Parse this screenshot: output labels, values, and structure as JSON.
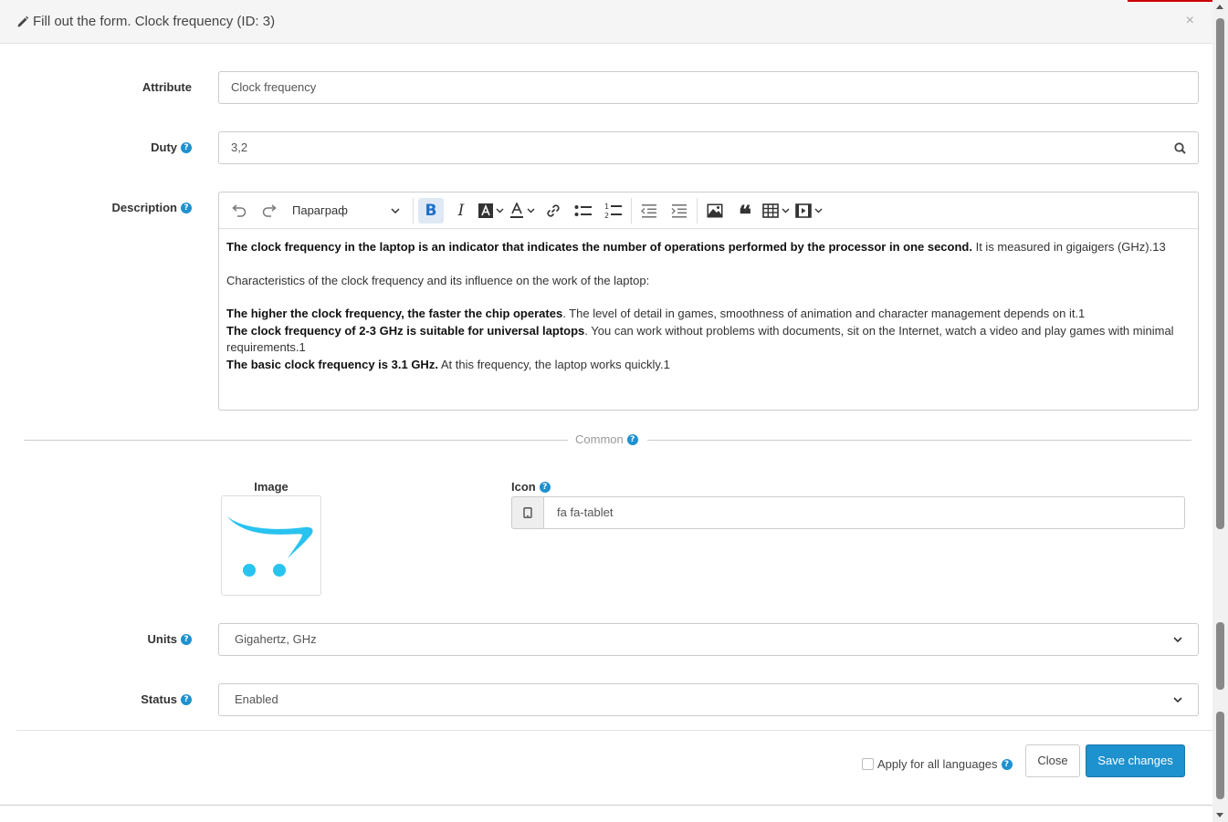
{
  "header": {
    "title": "Fill out the form. Clock frequency (ID: 3)",
    "close_label": "×"
  },
  "form": {
    "attribute": {
      "label": "Attribute",
      "value": "Clock frequency"
    },
    "duty": {
      "label": "Duty",
      "value": "3,2"
    },
    "description": {
      "label": "Description",
      "toolbar": {
        "paragraph_format": "Параграф"
      },
      "content": [
        {
          "bold": "The clock frequency in the laptop is an indicator that indicates the number of operations performed by the processor in one second.",
          "text": " It is measured in gigaigers (GHz).13"
        },
        {
          "bold": "",
          "text": "Characteristics of the clock frequency and its influence on the work of the laptop:"
        },
        {
          "bold": "The higher the clock frequency, the faster the chip operates",
          "text": ". The level of detail in games, smoothness of animation and character management depends on it.1"
        },
        {
          "bold": "The clock frequency of 2-3 GHz is suitable for universal laptops",
          "text": ". You can work without problems with documents, sit on the Internet, watch a video and play games with minimal requirements.1"
        },
        {
          "bold": "The basic clock frequency is 3.1 GHz.",
          "text": " At this frequency, the laptop works quickly.1"
        }
      ]
    },
    "section_common": "Common",
    "image": {
      "label": "Image"
    },
    "icon": {
      "label": "Icon",
      "value": "fa fa-tablet",
      "icon_name": "tablet-icon"
    },
    "units": {
      "label": "Units",
      "value": "Gigahertz, GHz"
    },
    "status": {
      "label": "Status",
      "value": "Enabled"
    }
  },
  "footer": {
    "apply_label": "Apply for all languages",
    "close_button": "Close",
    "save_button": "Save changes"
  },
  "colors": {
    "primary": "#1e91cf",
    "help_icon": "#1e91cf",
    "logo_cyan": "#29c3f0"
  }
}
